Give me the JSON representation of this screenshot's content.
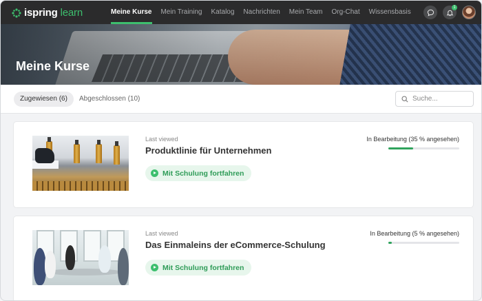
{
  "brand": {
    "name_part1": "ispring",
    "name_part2": "learn",
    "accent": "#3dbf6e"
  },
  "nav": {
    "items": [
      {
        "label": "Meine Kurse",
        "active": true
      },
      {
        "label": "Mein Training"
      },
      {
        "label": "Katalog"
      },
      {
        "label": "Nachrichten"
      },
      {
        "label": "Mein Team"
      },
      {
        "label": "Org-Chat"
      },
      {
        "label": "Wissensbasis"
      }
    ],
    "notification_count": "1"
  },
  "hero": {
    "title": "Meine Kurse"
  },
  "tabs": [
    {
      "label": "Zugewiesen (6)",
      "active": true
    },
    {
      "label": "Abgeschlossen (10)"
    }
  ],
  "search": {
    "placeholder": "Suche...",
    "value": ""
  },
  "courses": [
    {
      "last_viewed": "Last viewed",
      "title": "Produktlinie für Unternehmen",
      "button": "Mit Schulung fortfahren",
      "status": "In Bearbeitung (35 % angesehen)",
      "progress": 0.35
    },
    {
      "last_viewed": "Last viewed",
      "title": "Das Einmaleins der eCommerce-Schulung",
      "button": "Mit Schulung fortfahren",
      "status": "In Bearbeitung (5 % angesehen)",
      "progress": 0.05
    }
  ]
}
